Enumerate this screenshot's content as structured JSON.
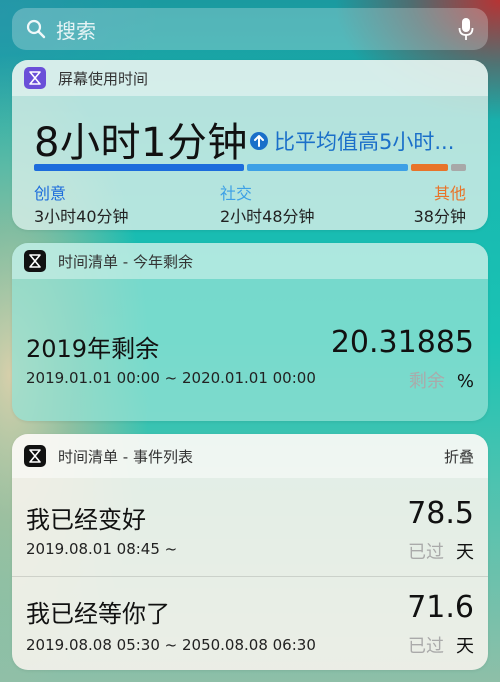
{
  "search": {
    "placeholder": "搜索",
    "icon": "search-icon",
    "mic_icon": "microphone-icon"
  },
  "screen_time": {
    "app_name": "屏幕使用时间",
    "app_icon": "hourglass-icon",
    "total": "8小时1分钟",
    "compare_icon": "arrow-up-circle-icon",
    "compare_text": "比平均值高5小时...",
    "categories": [
      {
        "label": "创意",
        "duration": "3小时40分钟",
        "color": "#1c6cdc"
      },
      {
        "label": "社交",
        "duration": "2小时48分钟",
        "color": "#3da0e6"
      },
      {
        "label": "其他",
        "duration": "38分钟",
        "color": "#e8742a"
      }
    ],
    "remainder_color": "#a8a8a8"
  },
  "year_widget": {
    "app_name": "时间清单 - 今年剩余",
    "app_icon": "hourglass-icon",
    "title": "2019年剩余",
    "range": "2019.01.01 00:00 ~ 2020.01.01 00:00",
    "value": "20.31885",
    "unit_label": "剩余",
    "unit": "%"
  },
  "events_widget": {
    "app_name": "时间清单 - 事件列表",
    "app_icon": "hourglass-icon",
    "collapse_label": "折叠",
    "events": [
      {
        "title": "我已经变好",
        "range": "2019.08.01 08:45 ~",
        "value": "78.5",
        "unit_label": "已过",
        "unit": "天"
      },
      {
        "title": "我已经等你了",
        "range": "2019.08.08 05:30 ~ 2050.08.08 06:30",
        "value": "71.6",
        "unit_label": "已过",
        "unit": "天"
      }
    ]
  }
}
